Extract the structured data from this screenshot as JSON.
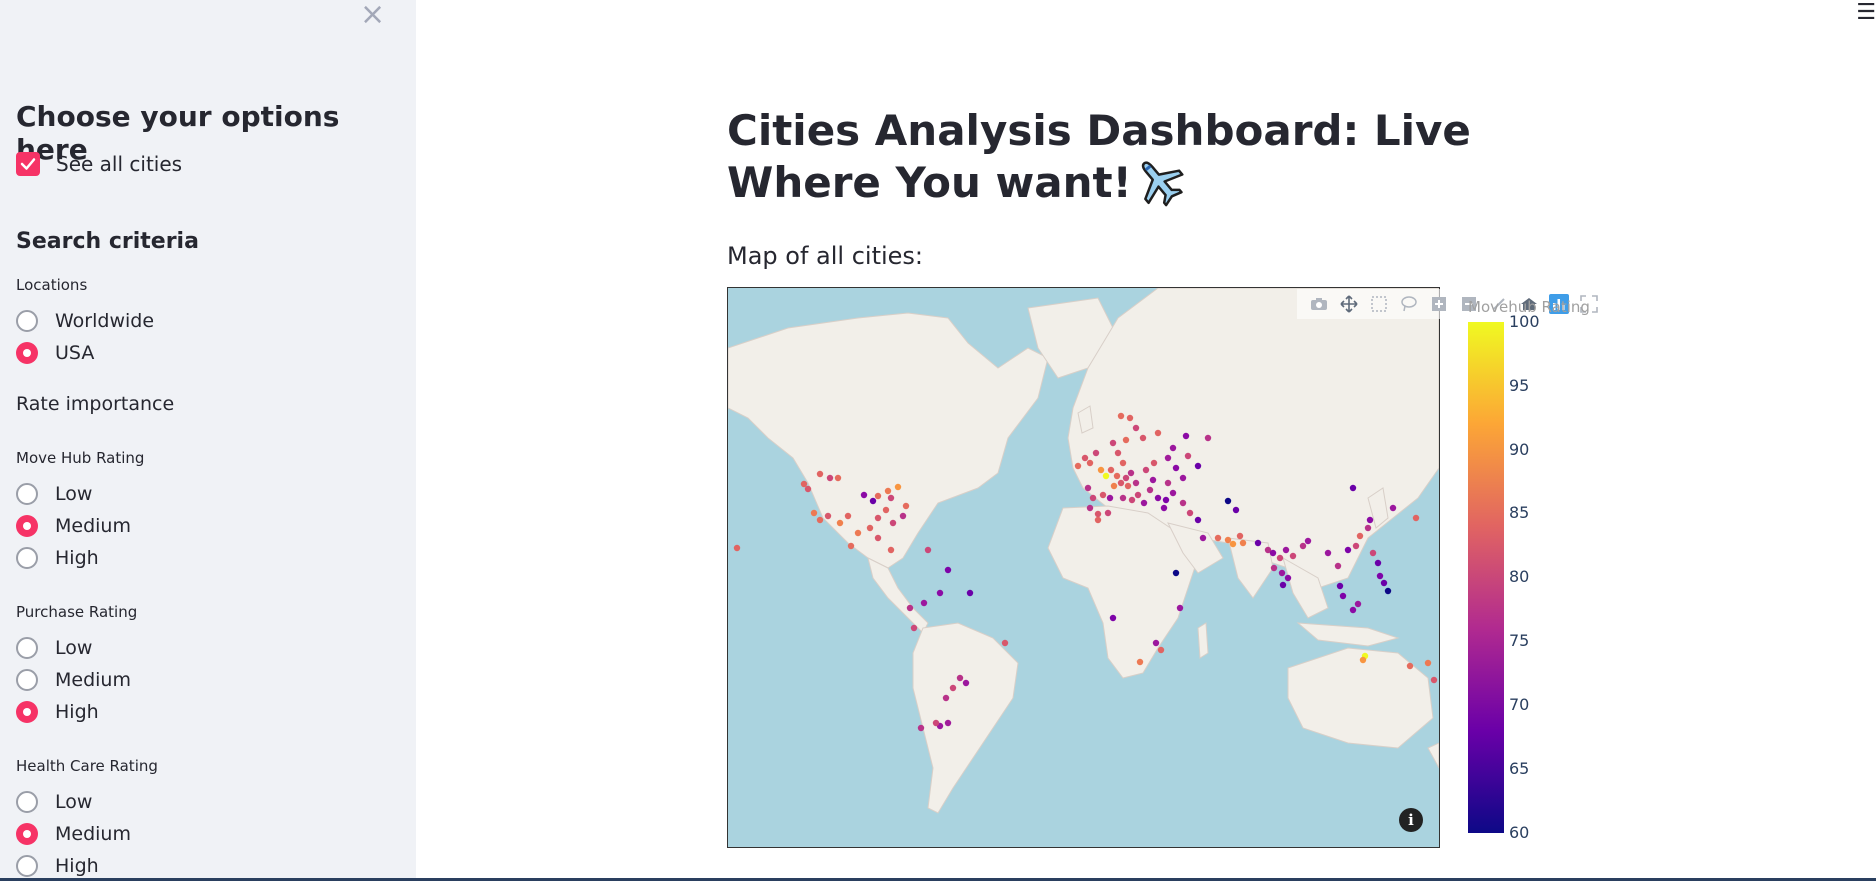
{
  "sidebar": {
    "close_icon": "×",
    "heading": "Choose your options here",
    "see_all": {
      "label": "See all cities",
      "checked": true
    },
    "search_heading": "Search criteria",
    "locations": {
      "label": "Locations",
      "options": [
        "Worldwide",
        "USA"
      ],
      "selected": "USA"
    },
    "rate_importance": "Rate importance",
    "move_hub": {
      "label": "Move Hub Rating",
      "options": [
        "Low",
        "Medium",
        "High"
      ],
      "selected": "Medium"
    },
    "purchase": {
      "label": "Purchase Rating",
      "options": [
        "Low",
        "Medium",
        "High"
      ],
      "selected": "High"
    },
    "health_care": {
      "label": "Health Care Rating",
      "options": [
        "Low",
        "Medium",
        "High"
      ],
      "selected": "Medium"
    }
  },
  "main": {
    "title": "Cities Analysis Dashboard: Live Where You want!",
    "map_label": "Map of all cities:",
    "hamburger_icon": "☰"
  },
  "map": {
    "colorbar_title": "Movehub Rating",
    "colorbar_ticks": [
      "100",
      "95",
      "90",
      "85",
      "80",
      "75",
      "70",
      "65",
      "60"
    ],
    "colorscale": [
      "#0d0887",
      "#6a00a8",
      "#b12a90",
      "#e16462",
      "#fca636",
      "#f0f921"
    ],
    "info_icon": "i",
    "modebar_icons": [
      "camera-icon",
      "pan-icon",
      "box-select-icon",
      "lasso-icon",
      "zoom-in-icon",
      "zoom-out-icon",
      "reset-icon",
      "home-icon",
      "plotly-logo-icon"
    ],
    "land_color": "#f2efe9",
    "water_color": "#aad3df"
  }
}
